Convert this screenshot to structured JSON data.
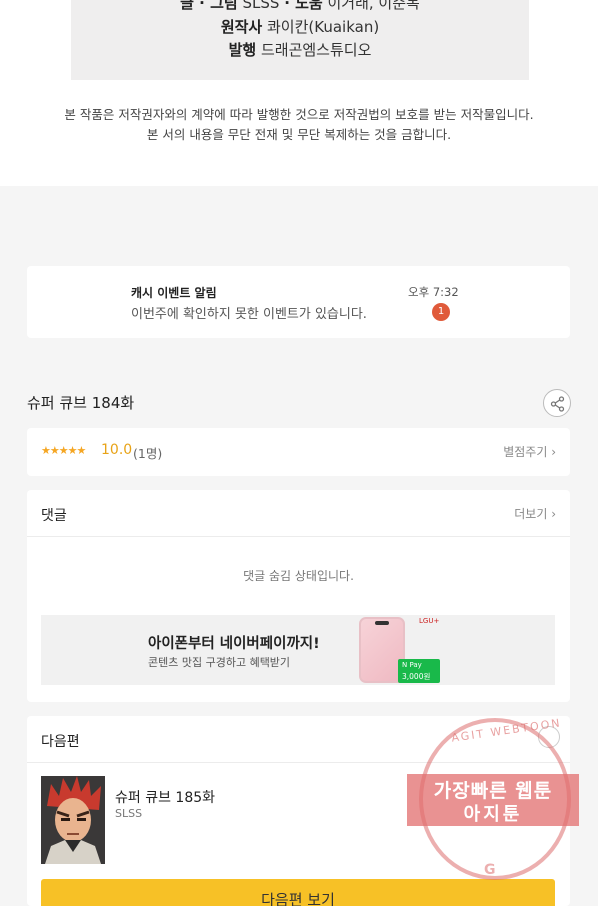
{
  "credits": {
    "line1_label": "글 · 그림",
    "line1_value": "SLSS",
    "line1_label2": "· 도움",
    "line1_value2": "이거래, 이준복",
    "line2_label": "원작사",
    "line2_value": "콰이칸(Kuaikan)",
    "line3_label": "발행",
    "line3_value": "드래곤엠스튜디오"
  },
  "copyright": {
    "line1": "본 작품은 저작권자와의 계약에 따라 발행한 것으로 저작권법의 보호를 받는 저작물입니다.",
    "line2": "본 서의 내용을 무단 전재 및 무단 복제하는 것을 금합니다."
  },
  "notification": {
    "title": "캐시 이벤트 알림",
    "text": "이번주에 확인하지 못한 이벤트가 있습니다.",
    "time": "오후 7:32",
    "badge": "1"
  },
  "episode": {
    "title": "슈퍼 큐브 184화",
    "share_icon": "share-icon"
  },
  "rating": {
    "stars": "★★★★★",
    "score": "10.0",
    "count": "(1명)",
    "rate_link": "별점주기 ›"
  },
  "comments": {
    "title": "댓글",
    "more": "더보기 ›",
    "hidden_text": "댓글 숨김 상태입니다."
  },
  "ad": {
    "title": "아이폰부터 네이버페이까지!",
    "subtitle": "콘텐츠 맛집 구경하고 혜택받기",
    "brand": "LGU+",
    "pay_label": "N Pay",
    "pay_amount": "3,000원"
  },
  "next": {
    "title": "다음편",
    "episode_title": "슈퍼 큐브 185화",
    "author": "SLSS",
    "button": "다음편 보기"
  },
  "watermark": {
    "arc_text": "AGIT WEBTOON",
    "line1": "가장빠른 웹툰",
    "line2": "아지툰",
    "letter": "G"
  }
}
